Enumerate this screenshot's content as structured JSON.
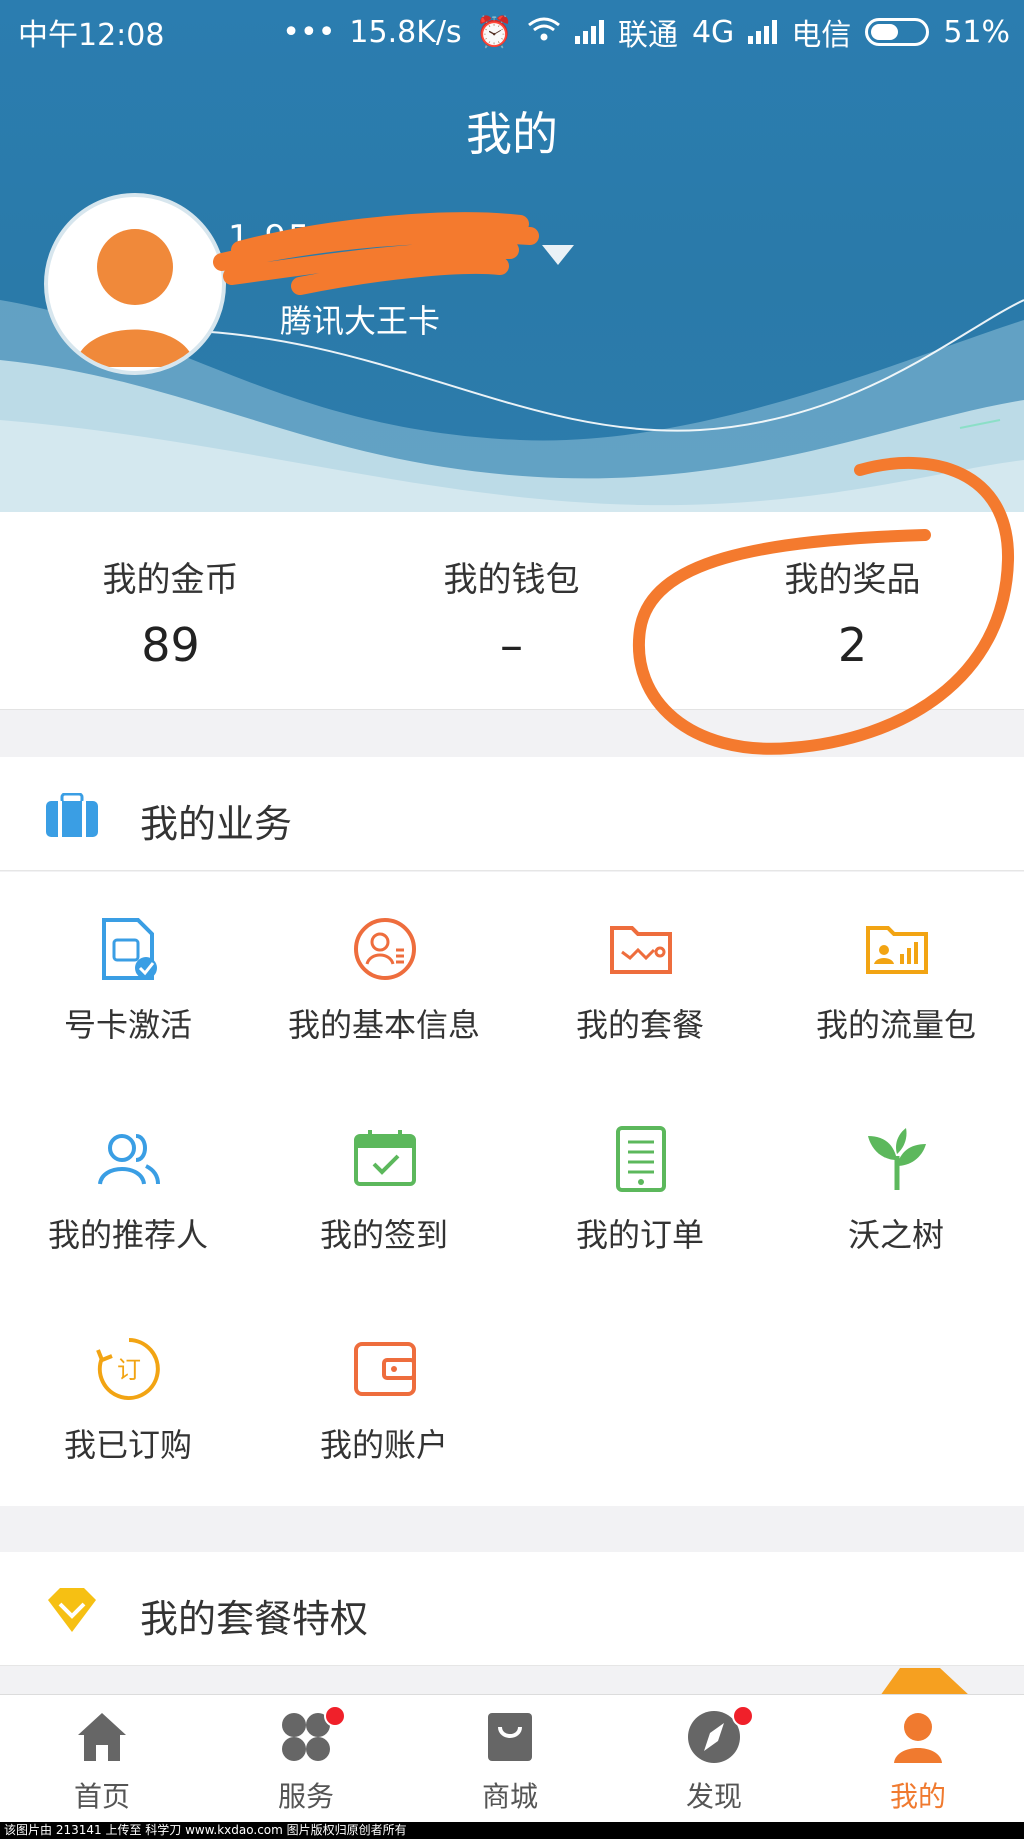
{
  "status_bar": {
    "time": "中午12:08",
    "dots": "•••",
    "speed": "15.8K/s",
    "carrier1": "联通",
    "network": "4G",
    "carrier2": "电信",
    "battery_percent": "51%",
    "battery_level": 0.51
  },
  "header": {
    "title": "我的",
    "phone_visible_fragment": "1          95",
    "card_name": "腾讯大王卡"
  },
  "stats": [
    {
      "label": "我的金币",
      "value": "89"
    },
    {
      "label": "我的钱包",
      "value": "–"
    },
    {
      "label": "我的奖品",
      "value": "2"
    }
  ],
  "business": {
    "title": "我的业务",
    "items": [
      {
        "label": "号卡激活",
        "icon": "sim-activate-icon"
      },
      {
        "label": "我的基本信息",
        "icon": "profile-info-icon"
      },
      {
        "label": "我的套餐",
        "icon": "package-icon"
      },
      {
        "label": "我的流量包",
        "icon": "data-pack-icon"
      },
      {
        "label": "我的推荐人",
        "icon": "referrer-icon"
      },
      {
        "label": "我的签到",
        "icon": "checkin-calendar-icon"
      },
      {
        "label": "我的订单",
        "icon": "order-icon"
      },
      {
        "label": "沃之树",
        "icon": "tree-icon"
      },
      {
        "label": "我已订购",
        "icon": "subscribed-icon"
      },
      {
        "label": "我的账户",
        "icon": "wallet-account-icon"
      }
    ]
  },
  "privilege": {
    "title": "我的套餐特权"
  },
  "bottom_nav": [
    {
      "label": "首页",
      "icon": "home-icon",
      "badge": false,
      "active": false
    },
    {
      "label": "服务",
      "icon": "service-grid-icon",
      "badge": true,
      "active": false
    },
    {
      "label": "商城",
      "icon": "shopping-bag-icon",
      "badge": false,
      "active": false
    },
    {
      "label": "发现",
      "icon": "compass-icon",
      "badge": true,
      "active": false
    },
    {
      "label": "我的",
      "icon": "user-icon",
      "badge": false,
      "active": true
    }
  ],
  "footer": {
    "text": "该图片由 213141 上传至 科学刀 www.kxdao.com 图片版权归原创者所有"
  },
  "colors": {
    "header_blue": "#2b7db0",
    "accent_orange": "#f07a2f",
    "badge_red": "#f0202a"
  }
}
